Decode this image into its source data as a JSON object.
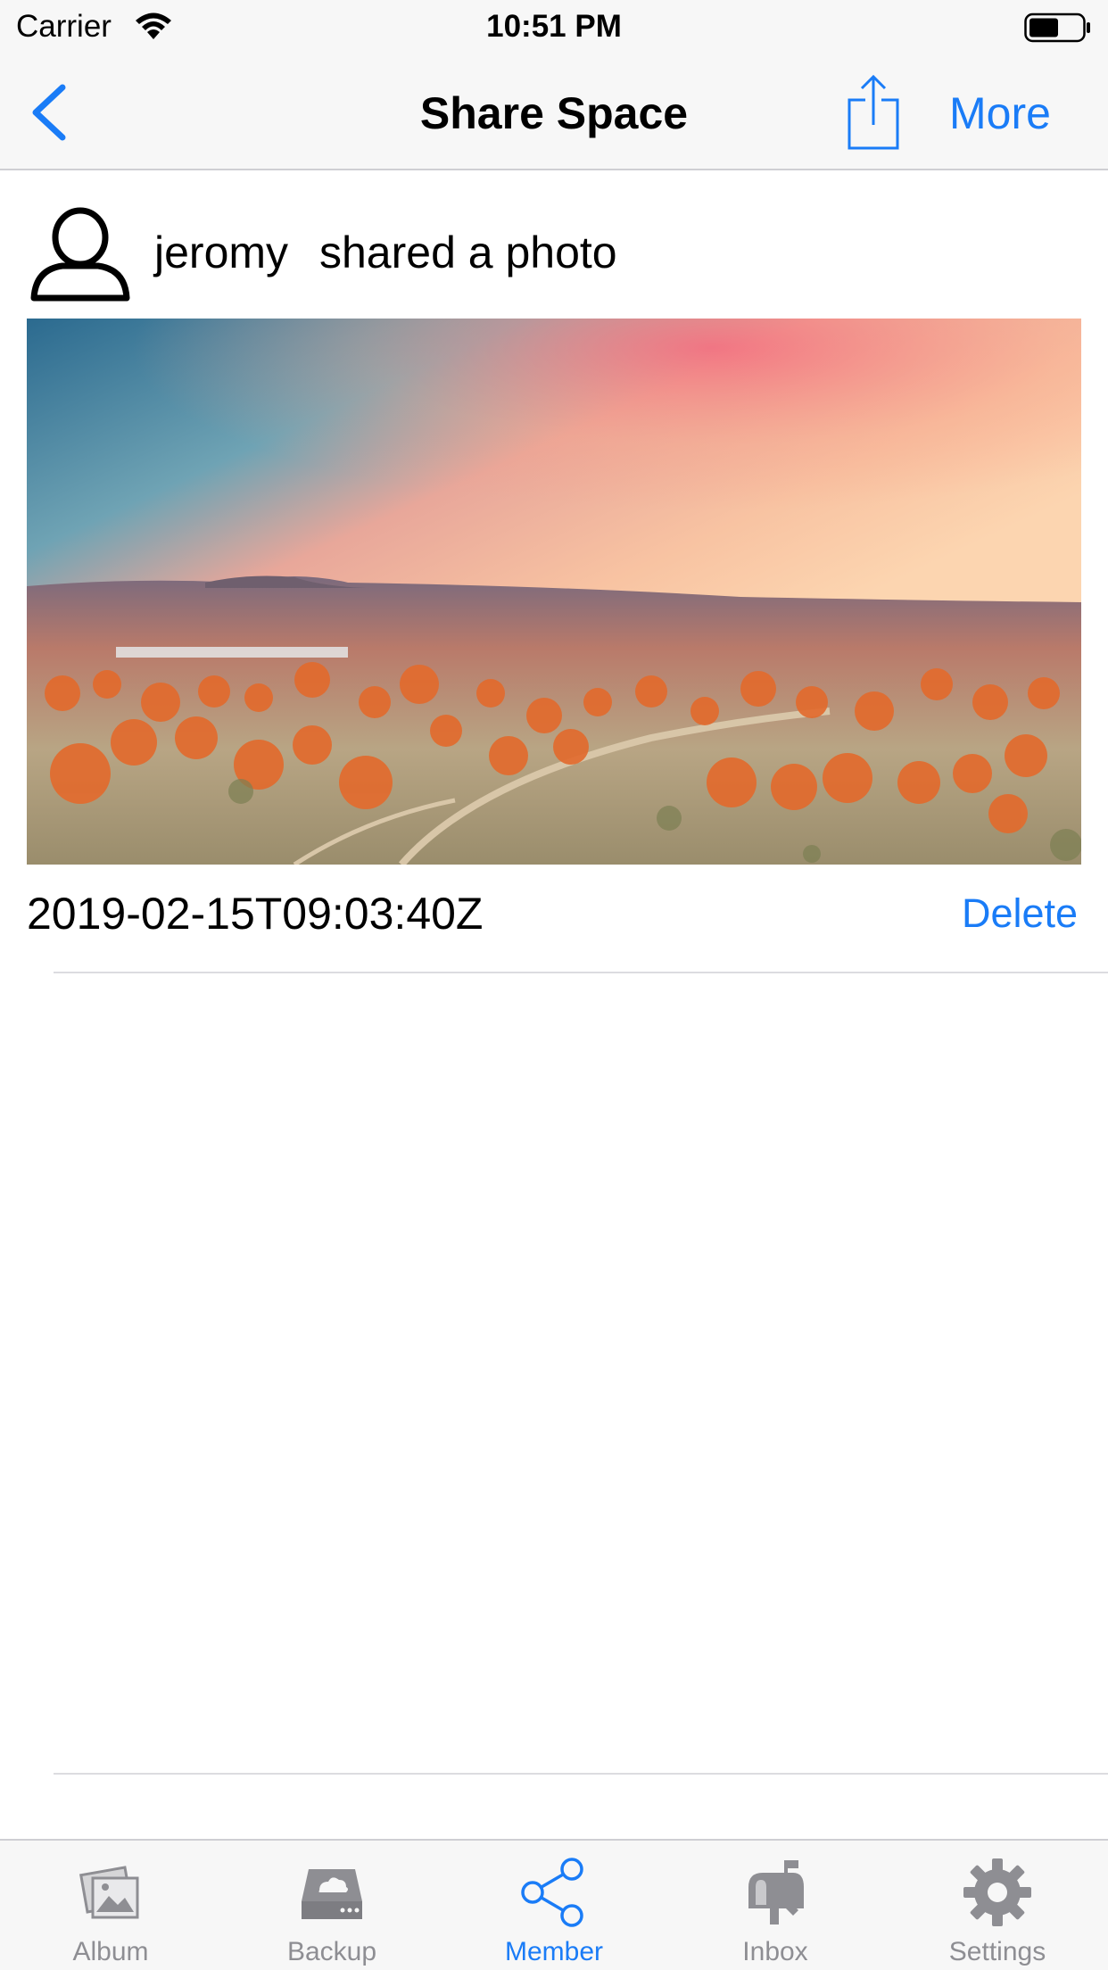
{
  "status_bar": {
    "carrier": "Carrier",
    "time": "10:51 PM"
  },
  "nav": {
    "title": "Share Space",
    "more_label": "More"
  },
  "post": {
    "author": "jeromy",
    "action": "shared a photo",
    "timestamp": "2019-02-15T09:03:40Z",
    "delete_label": "Delete"
  },
  "tabs": [
    {
      "label": "Album",
      "icon": "album-icon"
    },
    {
      "label": "Backup",
      "icon": "backup-drive-icon"
    },
    {
      "label": "Member",
      "icon": "share-icon"
    },
    {
      "label": "Inbox",
      "icon": "mailbox-icon"
    },
    {
      "label": "Settings",
      "icon": "gear-icon"
    }
  ],
  "active_tab": "Member",
  "colors": {
    "accent": "#1a7cf7",
    "inactive": "#8e8e93",
    "bar_background": "#f7f7f7"
  }
}
